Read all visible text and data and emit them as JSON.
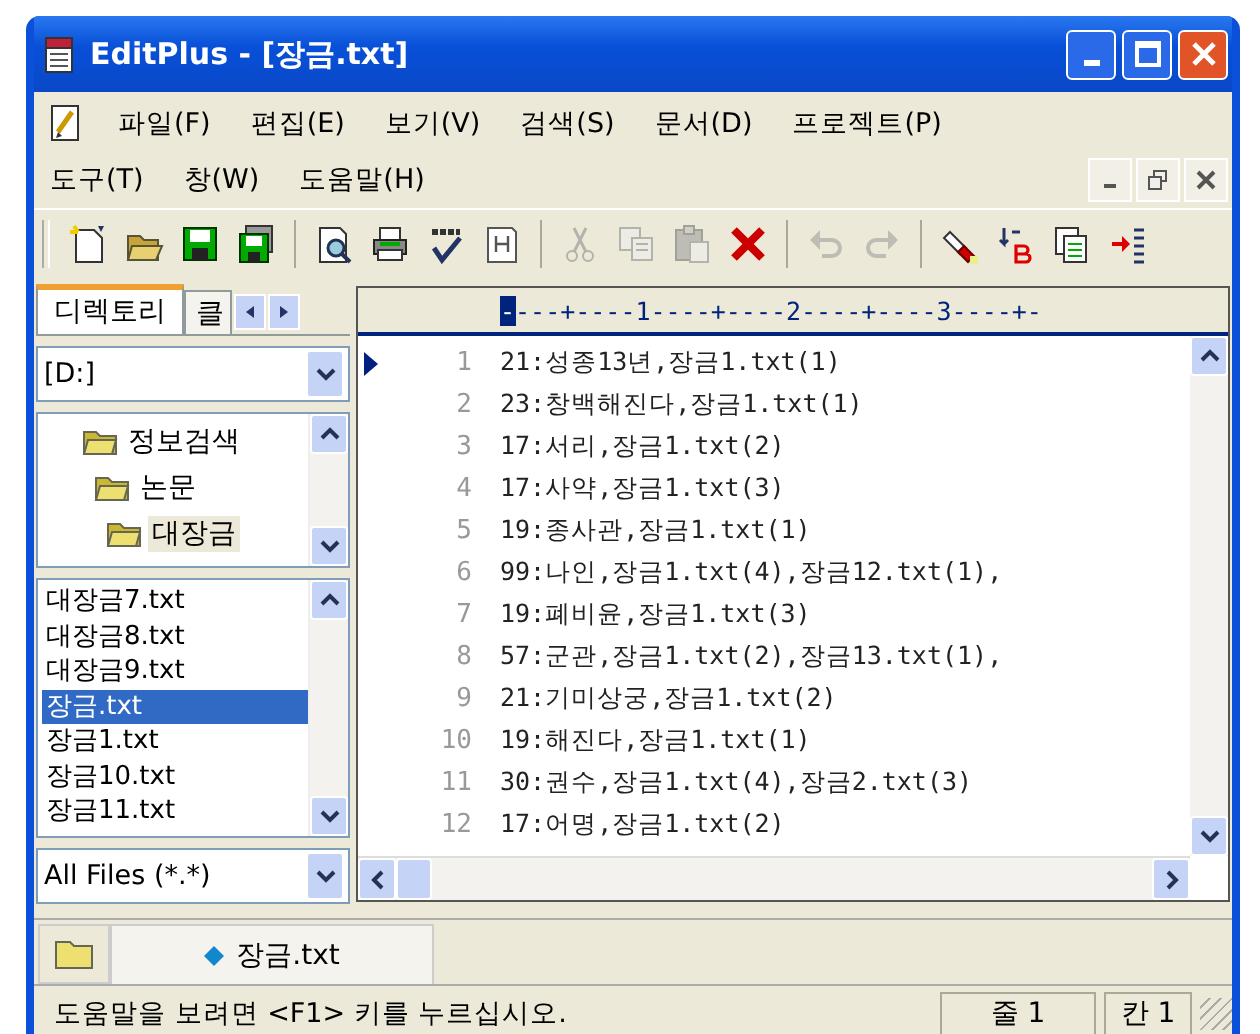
{
  "window": {
    "title": "EditPlus - [장금.txt]"
  },
  "menu_rows": [
    [
      "파일(F)",
      "편집(E)",
      "보기(V)",
      "검색(S)",
      "문서(D)",
      "프로젝트(P)"
    ],
    [
      "도구(T)",
      "창(W)",
      "도움말(H)"
    ]
  ],
  "toolbar": [
    {
      "kind": "new",
      "disabled": false
    },
    {
      "kind": "open",
      "disabled": false
    },
    {
      "kind": "save",
      "disabled": false
    },
    {
      "kind": "saveall",
      "disabled": false
    },
    {
      "kind": "separator"
    },
    {
      "kind": "preview",
      "disabled": false
    },
    {
      "kind": "print",
      "disabled": false
    },
    {
      "kind": "spell",
      "disabled": false
    },
    {
      "kind": "html",
      "disabled": false
    },
    {
      "kind": "separator"
    },
    {
      "kind": "cut",
      "disabled": true
    },
    {
      "kind": "copy",
      "disabled": true
    },
    {
      "kind": "paste",
      "disabled": true
    },
    {
      "kind": "delete",
      "disabled": false
    },
    {
      "kind": "separator"
    },
    {
      "kind": "undo",
      "disabled": true
    },
    {
      "kind": "redo",
      "disabled": true
    },
    {
      "kind": "separator"
    },
    {
      "kind": "find",
      "disabled": false
    },
    {
      "kind": "replace",
      "disabled": false
    },
    {
      "kind": "copies",
      "disabled": false
    },
    {
      "kind": "indent",
      "disabled": false
    }
  ],
  "sidebar": {
    "tabs": [
      {
        "label": "디렉토리",
        "selected": true
      },
      {
        "label": "클",
        "selected": false
      }
    ],
    "drive": "[D:]",
    "tree": [
      {
        "label": "정보검색",
        "selected": false,
        "children": [
          {
            "label": "논문",
            "selected": false,
            "children": [
              {
                "label": "대장금",
                "selected": true
              }
            ]
          }
        ]
      }
    ],
    "files": [
      {
        "label": "대장금7.txt",
        "selected": false
      },
      {
        "label": "대장금8.txt",
        "selected": false
      },
      {
        "label": "대장금9.txt",
        "selected": false
      },
      {
        "label": "장금.txt",
        "selected": true
      },
      {
        "label": "장금1.txt",
        "selected": false
      },
      {
        "label": "장금10.txt",
        "selected": false
      },
      {
        "label": "장금11.txt",
        "selected": false
      }
    ],
    "filter": "All Files (*.*)"
  },
  "editor": {
    "ruler": {
      "cursor": "-",
      "rest": "---+----1----+----2----+----3----+-"
    },
    "lines": [
      {
        "number": "1",
        "text": "21:성종13년,장금1.txt(1)",
        "current": true
      },
      {
        "number": "2",
        "text": "23:창백해진다,장금1.txt(1)",
        "current": false
      },
      {
        "number": "3",
        "text": "17:서리,장금1.txt(2)",
        "current": false
      },
      {
        "number": "4",
        "text": "17:사약,장금1.txt(3)",
        "current": false
      },
      {
        "number": "5",
        "text": "19:종사관,장금1.txt(1)",
        "current": false
      },
      {
        "number": "6",
        "text": "99:나인,장금1.txt(4),장금12.txt(1),",
        "current": false
      },
      {
        "number": "7",
        "text": "19:폐비윤,장금1.txt(3)",
        "current": false
      },
      {
        "number": "8",
        "text": "57:군관,장금1.txt(2),장금13.txt(1),",
        "current": false
      },
      {
        "number": "9",
        "text": "21:기미상궁,장금1.txt(2)",
        "current": false
      },
      {
        "number": "10",
        "text": "19:해진다,장금1.txt(1)",
        "current": false
      },
      {
        "number": "11",
        "text": "30:권수,장금1.txt(4),장금2.txt(3)",
        "current": false
      },
      {
        "number": "12",
        "text": "17:어명,장금1.txt(2)",
        "current": false
      }
    ]
  },
  "document_tabs": [
    {
      "label": "장금.txt",
      "selected": true
    }
  ],
  "status_bar": {
    "message": "도움말을 보려면 <F1> 키를 누르십시오.",
    "line": "줄 1",
    "column": "칸 1"
  }
}
